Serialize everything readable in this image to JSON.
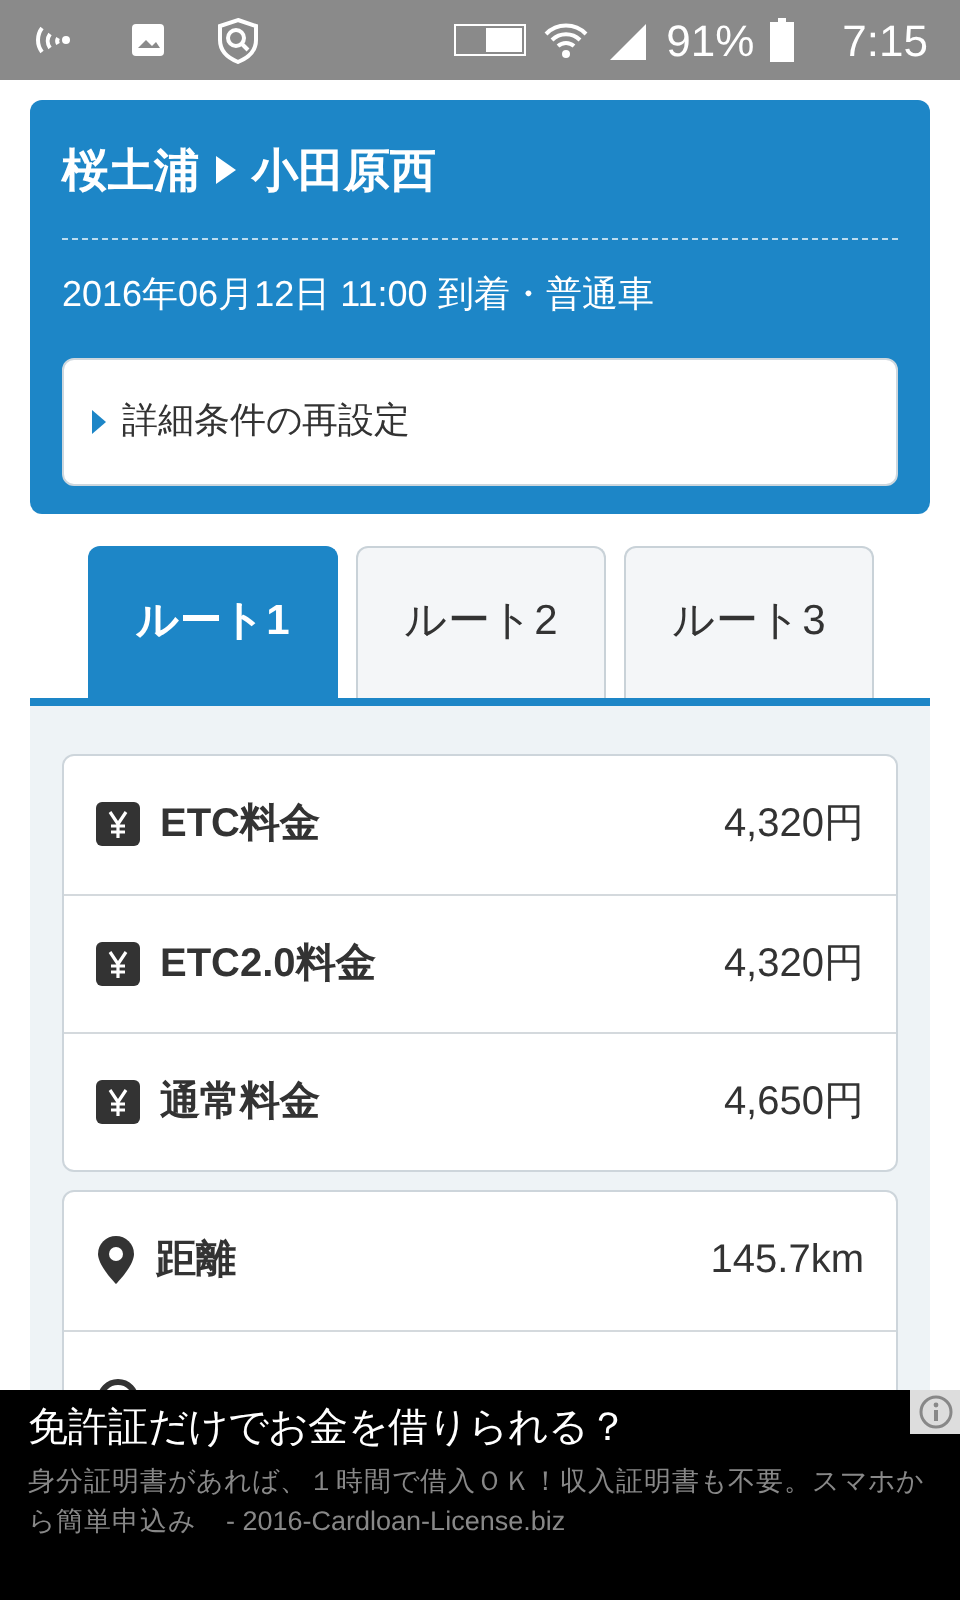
{
  "status_bar": {
    "battery": "91%",
    "time": "7:15"
  },
  "route": {
    "from": "桜土浦",
    "to": "小田原西",
    "datetime": "2016年06月12日 11:00 到着・普通車"
  },
  "settings_button": {
    "label": "詳細条件の再設定"
  },
  "tabs": [
    {
      "label": "ルート1",
      "selected": true
    },
    {
      "label": "ルート2",
      "selected": false
    },
    {
      "label": "ルート3",
      "selected": false
    }
  ],
  "fees": [
    {
      "label": "ETC料金",
      "value": "4,320円"
    },
    {
      "label": "ETC2.0料金",
      "value": "4,320円"
    },
    {
      "label": "通常料金",
      "value": "4,650円"
    }
  ],
  "details": [
    {
      "kind": "distance",
      "label": "距離",
      "value": "145.7km"
    },
    {
      "kind": "time"
    }
  ],
  "ad": {
    "title": "免許証だけでお金を借りられる？",
    "text": "身分証明書があれば、１時間で借入ＯＫ！収入証明書も不要。スマホから簡単申込み",
    "source": "- 2016-Cardloan-License.biz"
  }
}
